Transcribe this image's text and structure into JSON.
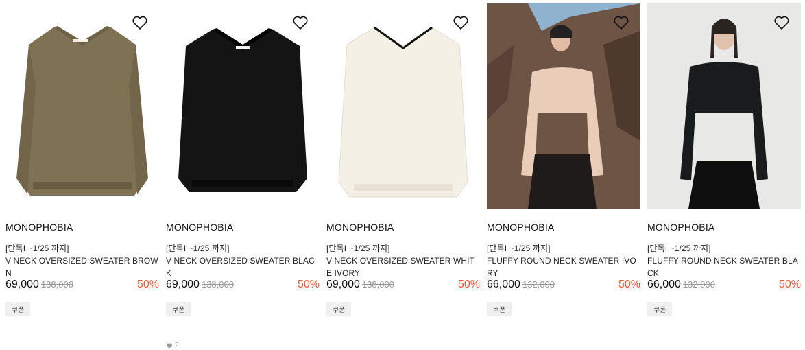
{
  "products": [
    {
      "brand": "MONOPHOBIA",
      "tag": "[단독I ~1/25 까지]",
      "name": "V NECK OVERSIZED SWEATER BROWN",
      "price": "69,000",
      "original_price": "138,000",
      "discount": "50%",
      "coupon": "쿠폰",
      "image": "sweater-brown-flat",
      "sweater_color": "#7f7154"
    },
    {
      "brand": "MONOPHOBIA",
      "tag": "[단독I ~1/25 까지]",
      "name": "V NECK OVERSIZED SWEATER BLACK",
      "price": "69,000",
      "original_price": "138,000",
      "discount": "50%",
      "coupon": "쿠폰",
      "likes": "2",
      "image": "sweater-black-flat",
      "sweater_color": "#141414"
    },
    {
      "brand": "MONOPHOBIA",
      "tag": "[단독I ~1/25 까지]",
      "name": "V NECK OVERSIZED SWEATER WHITE IVORY",
      "price": "69,000",
      "original_price": "138,000",
      "discount": "50%",
      "coupon": "쿠폰",
      "image": "sweater-ivory-flat",
      "sweater_color": "#f4f0e6"
    },
    {
      "brand": "MONOPHOBIA",
      "tag": "[단독I ~1/25 까지]",
      "name": "FLUFFY ROUND NECK SWEATER IVORY",
      "price": "66,000",
      "original_price": "132,000",
      "discount": "50%",
      "coupon": "쿠폰",
      "image": "model-ivory-rocks",
      "sweater_color": "#e9cdb8"
    },
    {
      "brand": "MONOPHOBIA",
      "tag": "[단독I ~1/25 까지]",
      "name": "FLUFFY ROUND NECK SWEATER BLACK",
      "price": "66,000",
      "original_price": "132,000",
      "discount": "50%",
      "coupon": "쿠폰",
      "image": "model-black-studio",
      "sweater_color": "#1a1b1d"
    }
  ],
  "colors": {
    "discount": "#ee5a3a",
    "strike": "#999999"
  }
}
